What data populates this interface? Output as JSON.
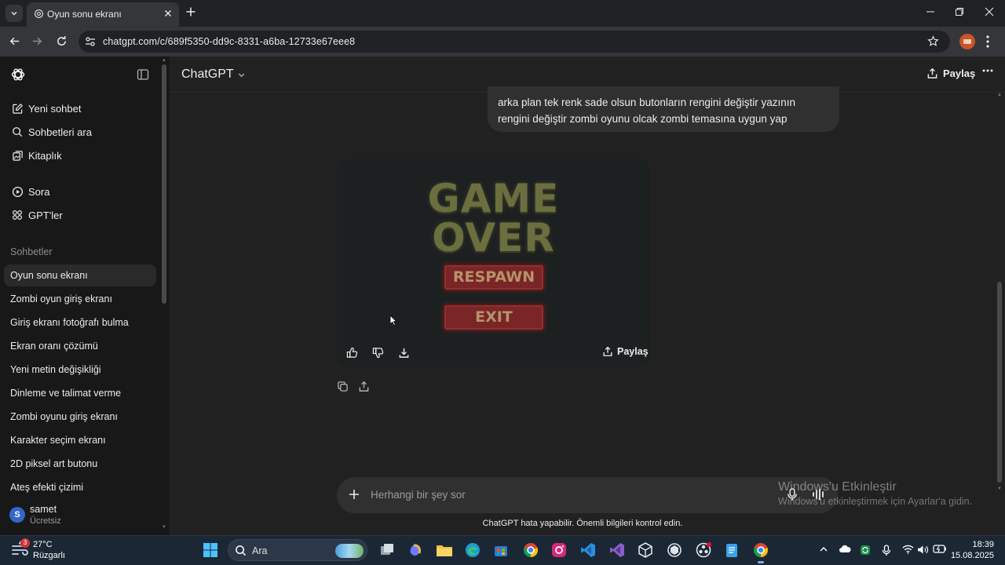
{
  "browser": {
    "tab_title": "Oyun sonu ekranı",
    "url": "chatgpt.com/c/689f5350-dd9c-8331-a6ba-12733e67eee8"
  },
  "sidebar": {
    "nav": [
      {
        "label": "Yeni sohbet",
        "icon": "edit-icon"
      },
      {
        "label": "Sohbetleri ara",
        "icon": "search-icon"
      },
      {
        "label": "Kitaplık",
        "icon": "library-icon"
      },
      {
        "label": "Sora",
        "icon": "play-circle-icon"
      },
      {
        "label": "GPT'ler",
        "icon": "grid-icon"
      }
    ],
    "section_title": "Sohbetler",
    "chats": [
      "Oyun sonu ekranı",
      "Zombi oyun giriş ekranı",
      "Giriş ekranı fotoğrafı bulma",
      "Ekran oranı çözümü",
      "Yeni metin değişikliği",
      "Dinleme ve talimat verme",
      "Zombi oyunu giriş ekranı",
      "Karakter seçim ekranı",
      "2D piksel art butonu",
      "Ateş efekti çizimi"
    ],
    "user": {
      "initial": "S",
      "name": "samet",
      "plan": "Ücretsiz"
    }
  },
  "header": {
    "model": "ChatGPT",
    "share_label": "Paylaş"
  },
  "conversation": {
    "user_message": "arka plan tek renk sade olsun butonların rengini değiştir yazının rengini değiştir zombi oyunu olcak zombi temasına uygun yap",
    "image": {
      "line1": "GAME",
      "line2": "OVER",
      "button1": "RESPAWN",
      "button2": "EXIT"
    },
    "card_share_label": "Paylaş"
  },
  "composer": {
    "placeholder": "Herhangi bir şey sor"
  },
  "disclaimer": "ChatGPT hata yapabilir. Önemli bilgileri kontrol edin.",
  "watermark": {
    "title": "Windows'u Etkinleştir",
    "subtitle": "Windows'u etkinleştirmek için Ayarlar'a gidin."
  },
  "taskbar": {
    "temperature": "27°C",
    "condition": "Rüzgarlı",
    "weather_badge": "3",
    "search_label": "Ara",
    "time": "18:39",
    "date": "15.08.2025"
  },
  "colors": {
    "sidebar_bg": "#181818",
    "main_bg": "#212121",
    "bubble_bg": "#303030",
    "zombie_text": "#6b6e3e",
    "zombie_button": "#7a2526"
  }
}
